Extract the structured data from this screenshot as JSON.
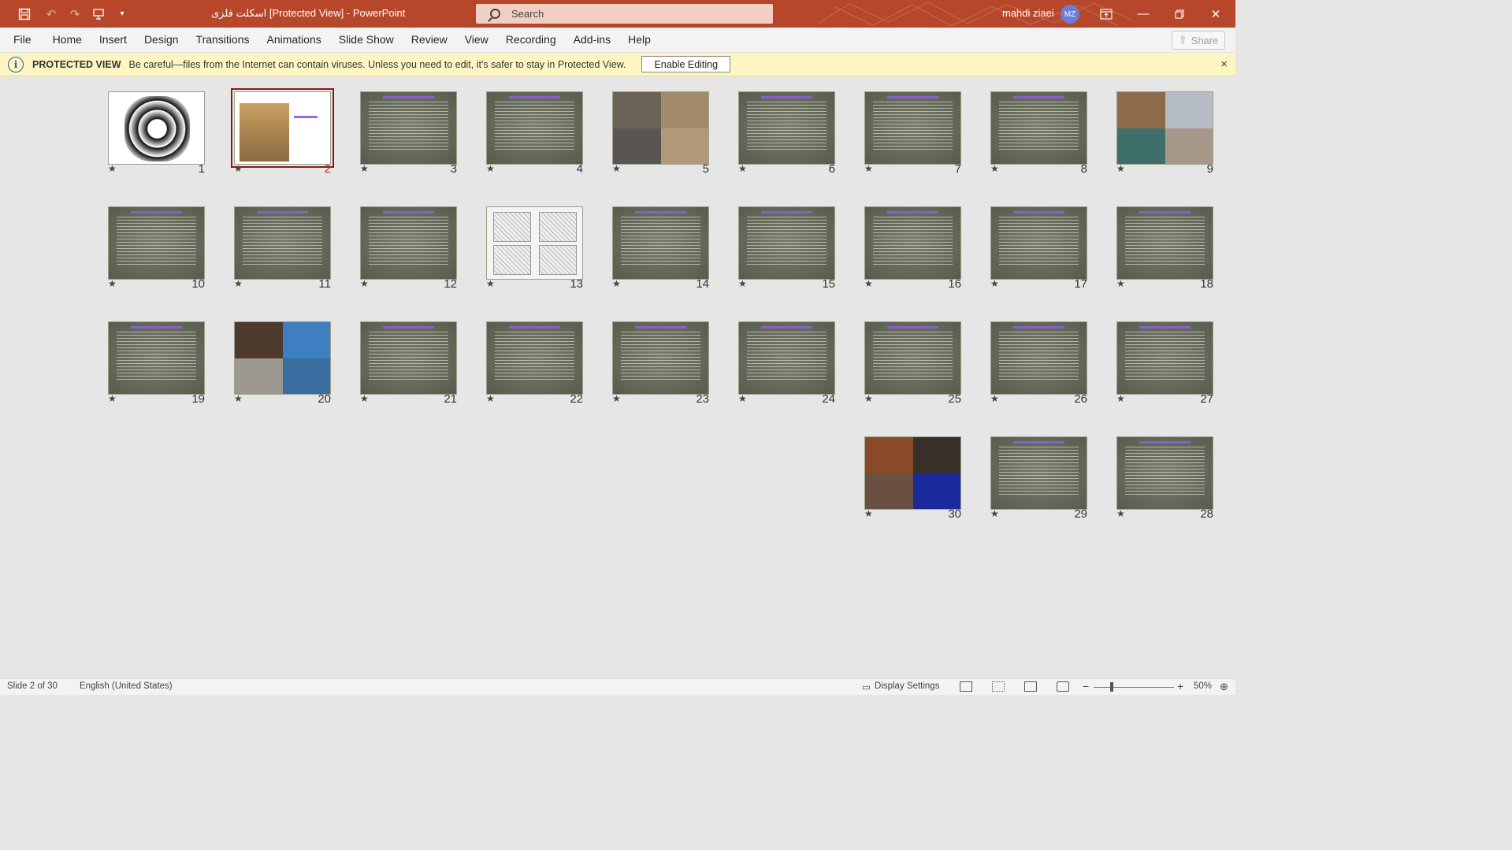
{
  "app": {
    "doc_title": "اسکلت فلزی  [Protected View]  -  PowerPoint",
    "search_placeholder": "Search",
    "user_name": "mahdi ziaei",
    "user_initials": "MZ"
  },
  "menu": [
    "File",
    "Home",
    "Insert",
    "Design",
    "Transitions",
    "Animations",
    "Slide Show",
    "Review",
    "View",
    "Recording",
    "Add-ins",
    "Help"
  ],
  "share_label": "Share",
  "protected_view": {
    "title": "PROTECTED VIEW",
    "message": "Be careful—files from the Internet can contain viruses. Unless you need to edit, it's safer to stay in Protected View.",
    "button": "Enable Editing",
    "close": "×"
  },
  "slides": [
    {
      "n": 9,
      "kind": "photo4"
    },
    {
      "n": 8,
      "kind": "text"
    },
    {
      "n": 7,
      "kind": "text"
    },
    {
      "n": 6,
      "kind": "text"
    },
    {
      "n": 5,
      "kind": "photo4b"
    },
    {
      "n": 4,
      "kind": "text"
    },
    {
      "n": 3,
      "kind": "text"
    },
    {
      "n": 2,
      "kind": "building",
      "selected": true
    },
    {
      "n": 1,
      "kind": "calligraphy"
    },
    {
      "n": 18,
      "kind": "text"
    },
    {
      "n": 17,
      "kind": "text"
    },
    {
      "n": 16,
      "kind": "text"
    },
    {
      "n": 15,
      "kind": "text"
    },
    {
      "n": 14,
      "kind": "text"
    },
    {
      "n": 13,
      "kind": "diagram"
    },
    {
      "n": 12,
      "kind": "text"
    },
    {
      "n": 11,
      "kind": "text"
    },
    {
      "n": 10,
      "kind": "text"
    },
    {
      "n": 27,
      "kind": "text"
    },
    {
      "n": 26,
      "kind": "text"
    },
    {
      "n": 25,
      "kind": "text"
    },
    {
      "n": 24,
      "kind": "text"
    },
    {
      "n": 23,
      "kind": "text"
    },
    {
      "n": 22,
      "kind": "text"
    },
    {
      "n": 21,
      "kind": "text"
    },
    {
      "n": 20,
      "kind": "photo4c"
    },
    {
      "n": 19,
      "kind": "text"
    },
    {
      "n": 30,
      "kind": "photo4d"
    },
    {
      "n": 29,
      "kind": "text"
    },
    {
      "n": 28,
      "kind": "text"
    }
  ],
  "status": {
    "slide_info": "Slide 2 of 30",
    "language": "English (United States)",
    "display_settings": "Display Settings",
    "zoom": "50%",
    "zoom_minus": "−",
    "zoom_plus": "+"
  },
  "colors": {
    "titlebar": "#b7472a",
    "slide_bg": "#6d7361",
    "selection": "#8a1a1a",
    "protected_bg": "#fdf6c3"
  }
}
